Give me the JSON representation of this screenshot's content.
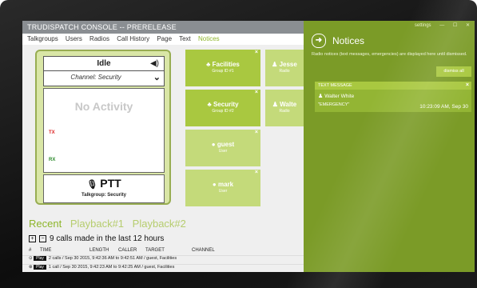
{
  "window": {
    "title": "TRUDISPATCH CONSOLE -- PRERELEASE"
  },
  "menu": {
    "items": [
      "Talkgroups",
      "Users",
      "Radios",
      "Call History",
      "Page",
      "Text",
      "Notices"
    ],
    "active": "Notices"
  },
  "radio_card": {
    "status": "Idle",
    "channel": "Channel: Security",
    "activity": "No Activity",
    "tx_label": "TX",
    "rx_label": "RX",
    "ptt_label": "PTT",
    "talkgroup": "Talkgroup: Security",
    "speaker_icon": "speaker-icon",
    "mic_icon": "microphone-icon"
  },
  "tiles": [
    {
      "name": "Facilities",
      "sub": "Group ID #1",
      "icon": "group-icon"
    },
    {
      "name": "Jesse",
      "sub": "Radio",
      "icon": "user-icon"
    },
    {
      "name": "Security",
      "sub": "Group ID #2",
      "icon": "group-icon"
    },
    {
      "name": "Walte",
      "sub": "Radio",
      "icon": "user-icon"
    },
    {
      "name": "guest",
      "sub": "User",
      "icon": "chat-icon"
    },
    {
      "name": "mark",
      "sub": "User",
      "icon": "chat-icon"
    }
  ],
  "recent": {
    "tabs": [
      "Recent",
      "Playback#1",
      "Playback#2"
    ],
    "active_tab": "Recent",
    "summary": "9 calls made in the last 12 hours",
    "columns": [
      "#",
      "TIME",
      "LENGTH",
      "CALLER",
      "TARGET",
      "CHANNEL"
    ],
    "rows": [
      {
        "play": "Play",
        "text": "2 calls / Sep 30 2015, 9:42:36 AM to 9:42:51 AM / guest, Facilities"
      },
      {
        "play": "Play",
        "text": "1 call / Sep 30 2015, 9:42:23 AM to 9:42:25 AM / guest, Facilities"
      }
    ]
  },
  "notices": {
    "window_controls": [
      "settings",
      "—",
      "☐",
      "✕"
    ],
    "title": "Notices",
    "description": "Radio notices (text messages, emergencies) are displayed here until dismissed.",
    "dismiss_label": "dismiss all",
    "message": {
      "type": "TEXT MESSAGE",
      "sender": "Walter White",
      "time": "10:23:09 AM, Sep 30",
      "body": "\"EMERGENCY\""
    }
  },
  "colors": {
    "accent": "#8db52a",
    "panel": "#7b9b27",
    "tile": "#a9c840"
  }
}
